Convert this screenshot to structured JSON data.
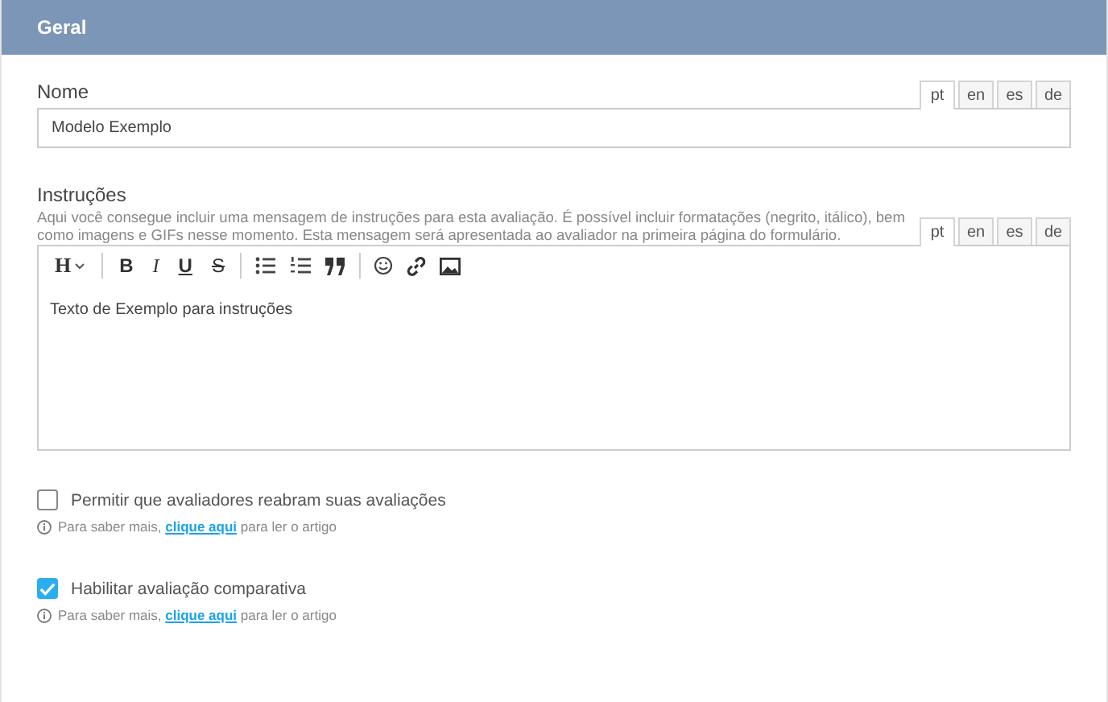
{
  "header": {
    "title": "Geral"
  },
  "name_field": {
    "label": "Nome",
    "value": "Modelo Exemplo",
    "languages": [
      {
        "label": "pt",
        "selected": true
      },
      {
        "label": "en",
        "selected": false
      },
      {
        "label": "es",
        "selected": false
      },
      {
        "label": "de",
        "selected": false
      }
    ]
  },
  "instructions": {
    "label": "Instruções",
    "description": "Aqui você consegue incluir uma mensagem de instruções para esta avaliação. É possível incluir formatações (negrito, itálico), bem como imagens e GIFs nesse momento. Esta mensagem será apresentada ao avaliador na primeira página do formulário.",
    "languages": [
      {
        "label": "pt",
        "selected": true
      },
      {
        "label": "en",
        "selected": false
      },
      {
        "label": "es",
        "selected": false
      },
      {
        "label": "de",
        "selected": false
      }
    ],
    "toolbar_letters": [
      "H",
      "B",
      "I",
      "U",
      "S"
    ],
    "content": "Texto de Exemplo para instruções"
  },
  "options": [
    {
      "label": "Permitir que avaliadores reabram suas avaliações",
      "checked": false,
      "info_before": "Para saber mais, ",
      "info_link": "clique aqui",
      "info_after": " para ler o artigo"
    },
    {
      "label": "Habilitar avaliação comparativa",
      "checked": true,
      "info_before": "Para saber mais, ",
      "info_link": "clique aqui",
      "info_after": " para ler o artigo"
    }
  ]
}
